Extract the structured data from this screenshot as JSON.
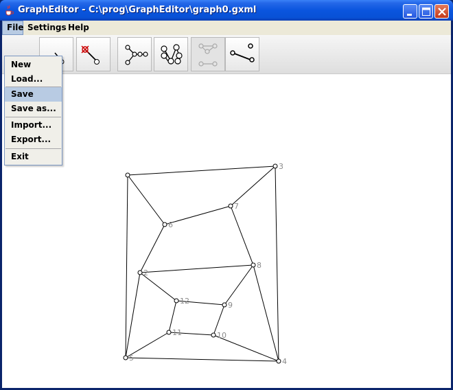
{
  "window": {
    "title": "GraphEditor - C:\\prog\\GraphEditor\\graph0.gxml",
    "icon": "java-cup-icon"
  },
  "menubar": {
    "items": [
      {
        "label": "File",
        "active": true
      },
      {
        "label": "Settings",
        "active": false
      },
      {
        "label": "Help",
        "active": false
      }
    ]
  },
  "file_menu": {
    "items": [
      {
        "label": "New"
      },
      {
        "label": "Load..."
      },
      {
        "label": "Save",
        "highlighted": true
      },
      {
        "label": "Save as..."
      },
      {
        "label": "Import..."
      },
      {
        "label": "Export..."
      },
      {
        "label": "Exit"
      }
    ]
  },
  "toolbar": {
    "tools": [
      {
        "icon": "add-edge-icon",
        "enabled": true
      },
      {
        "icon": "delete-node-icon",
        "enabled": true
      },
      {
        "icon": "tree-layout-icon",
        "enabled": true
      },
      {
        "icon": "auto-layout-icon",
        "enabled": true
      },
      {
        "icon": "grid-layout-icon",
        "enabled": false
      },
      {
        "icon": "edge-tool-icon",
        "enabled": true
      }
    ]
  },
  "graph": {
    "nodes": [
      {
        "id": "1",
        "label": ""
      },
      {
        "id": "2",
        "label": "2"
      },
      {
        "id": "3",
        "label": "3"
      },
      {
        "id": "4",
        "label": "4"
      },
      {
        "id": "5",
        "label": "5"
      },
      {
        "id": "6",
        "label": "6"
      },
      {
        "id": "7",
        "label": "7"
      },
      {
        "id": "8",
        "label": "8"
      },
      {
        "id": "9",
        "label": "9"
      },
      {
        "id": "10",
        "label": "10"
      },
      {
        "id": "11",
        "label": "11"
      },
      {
        "id": "12",
        "label": "12"
      }
    ],
    "edges": [
      [
        "1",
        "3"
      ],
      [
        "1",
        "5"
      ],
      [
        "1",
        "6"
      ],
      [
        "6",
        "2"
      ],
      [
        "6",
        "7"
      ],
      [
        "7",
        "3"
      ],
      [
        "7",
        "8"
      ],
      [
        "3",
        "4"
      ],
      [
        "2",
        "8"
      ],
      [
        "2",
        "12"
      ],
      [
        "2",
        "5"
      ],
      [
        "12",
        "9"
      ],
      [
        "12",
        "11"
      ],
      [
        "8",
        "9"
      ],
      [
        "8",
        "4"
      ],
      [
        "9",
        "10"
      ],
      [
        "11",
        "10"
      ],
      [
        "11",
        "5"
      ],
      [
        "10",
        "4"
      ],
      [
        "5",
        "4"
      ]
    ]
  },
  "colors": {
    "titlebar": "#0a55de",
    "menu_highlight": "#b8cbe3",
    "canvas_bg": "#ffffff",
    "node_label": "#8a8a8a"
  }
}
